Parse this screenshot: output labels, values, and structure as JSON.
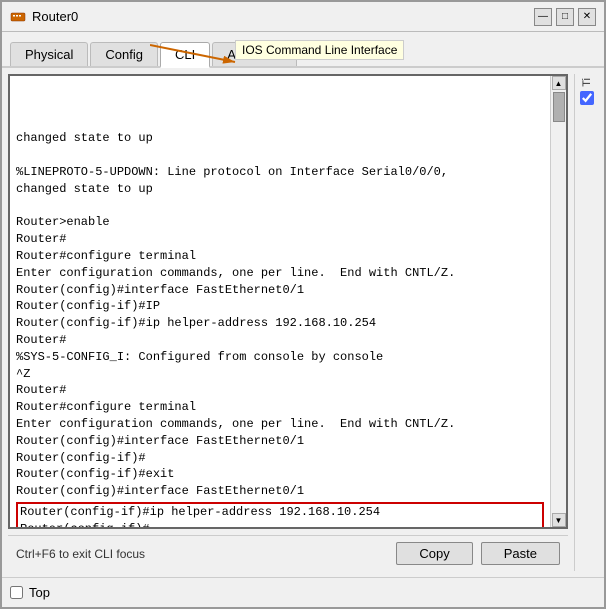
{
  "window": {
    "title": "Router0",
    "icon": "router-icon"
  },
  "titlebar": {
    "minimize_label": "—",
    "maximize_label": "□",
    "close_label": "✕"
  },
  "tabs": [
    {
      "label": "Physical",
      "active": false
    },
    {
      "label": "Config",
      "active": false
    },
    {
      "label": "CLI",
      "active": true
    },
    {
      "label": "Attributes",
      "active": false
    }
  ],
  "tooltip": {
    "text": "IOS Command Line Interface"
  },
  "terminal": {
    "lines": [
      {
        "text": "changed state to up",
        "highlighted": false
      },
      {
        "text": "",
        "highlighted": false
      },
      {
        "text": "%LINEPROTO-5-UPDOWN: Line protocol on Interface Serial0/0/0,",
        "highlighted": false
      },
      {
        "text": "changed state to up",
        "highlighted": false
      },
      {
        "text": "",
        "highlighted": false
      },
      {
        "text": "Router>enable",
        "highlighted": false
      },
      {
        "text": "Router#",
        "highlighted": false
      },
      {
        "text": "Router#configure terminal",
        "highlighted": false
      },
      {
        "text": "Enter configuration commands, one per line.  End with CNTL/Z.",
        "highlighted": false
      },
      {
        "text": "Router(config)#interface FastEthernet0/1",
        "highlighted": false
      },
      {
        "text": "Router(config-if)#IP",
        "highlighted": false
      },
      {
        "text": "Router(config-if)#ip helper-address 192.168.10.254",
        "highlighted": false
      },
      {
        "text": "Router#",
        "highlighted": false
      },
      {
        "text": "%SYS-5-CONFIG_I: Configured from console by console",
        "highlighted": false
      },
      {
        "text": "^Z",
        "highlighted": false
      },
      {
        "text": "Router#",
        "highlighted": false
      },
      {
        "text": "Router#configure terminal",
        "highlighted": false
      },
      {
        "text": "Enter configuration commands, one per line.  End with CNTL/Z.",
        "highlighted": false
      },
      {
        "text": "Router(config)#interface FastEthernet0/1",
        "highlighted": false
      },
      {
        "text": "Router(config-if)#",
        "highlighted": false
      },
      {
        "text": "Router(config-if)#exit",
        "highlighted": false
      },
      {
        "text": "Router(config)#interface FastEthernet0/1",
        "highlighted": false
      },
      {
        "text": "Router(config-if)#ip helper-address 192.168.10.254",
        "highlighted": true
      },
      {
        "text": "Router(config-if)#",
        "highlighted": true
      }
    ]
  },
  "bottom_bar": {
    "hint": "Ctrl+F6 to exit CLI focus",
    "copy_label": "Copy",
    "paste_label": "Paste"
  },
  "footer": {
    "top_label": "Top",
    "checkbox_checked": false
  },
  "right_panel": {
    "label": "Ti",
    "checkbox_checked": true
  }
}
